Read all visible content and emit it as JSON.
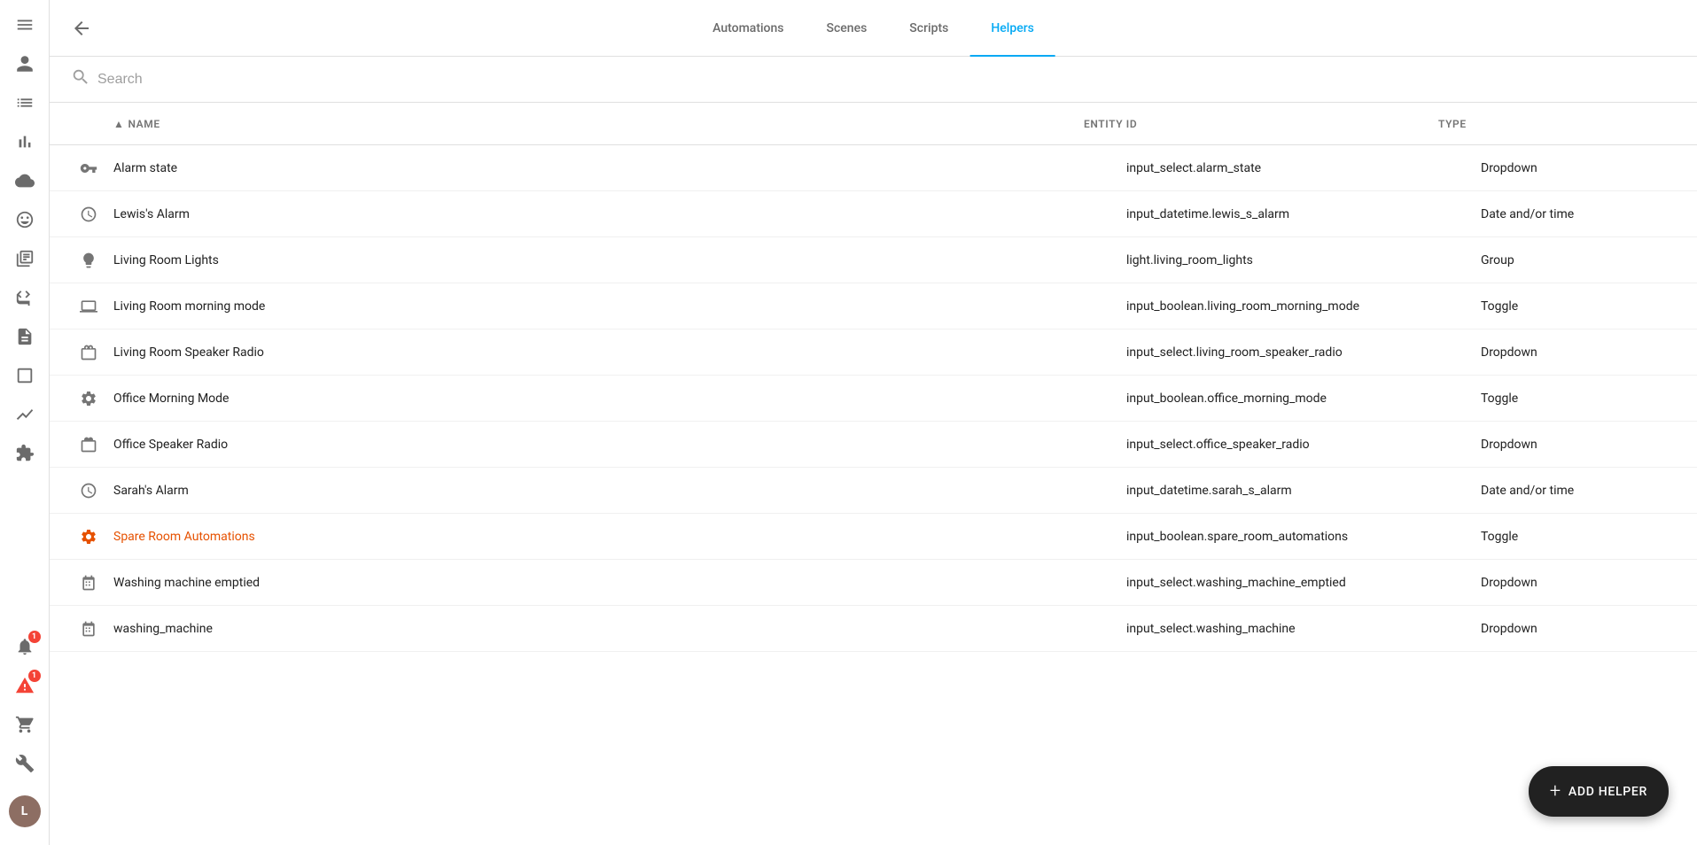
{
  "sidebar": {
    "icons": [
      {
        "name": "menu-icon",
        "symbol": "☰",
        "interactable": true
      },
      {
        "name": "person-icon",
        "symbol": "👤",
        "interactable": true
      },
      {
        "name": "list-icon",
        "symbol": "☰",
        "interactable": true
      },
      {
        "name": "chart-icon",
        "symbol": "📊",
        "interactable": true
      },
      {
        "name": "cloud-icon",
        "symbol": "☁",
        "interactable": true
      },
      {
        "name": "face-icon",
        "symbol": "😊",
        "interactable": true
      },
      {
        "name": "menu2-icon",
        "symbol": "≡",
        "interactable": true
      },
      {
        "name": "radar-icon",
        "symbol": "📡",
        "interactable": true
      },
      {
        "name": "document-icon",
        "symbol": "📋",
        "interactable": true
      },
      {
        "name": "box-icon",
        "symbol": "⬜",
        "interactable": true
      },
      {
        "name": "linechart-icon",
        "symbol": "📈",
        "interactable": true
      },
      {
        "name": "bell-icon",
        "symbol": "🔔",
        "interactable": true,
        "badge": "1"
      },
      {
        "name": "cart-icon",
        "symbol": "🛒",
        "interactable": true
      },
      {
        "name": "wrench-icon",
        "symbol": "🔧",
        "interactable": true
      }
    ],
    "notification_badge": "1"
  },
  "header": {
    "back_label": "←",
    "tabs": [
      {
        "label": "Automations",
        "active": false
      },
      {
        "label": "Scenes",
        "active": false
      },
      {
        "label": "Scripts",
        "active": false
      },
      {
        "label": "Helpers",
        "active": true
      }
    ]
  },
  "search": {
    "placeholder": "Search",
    "value": ""
  },
  "table": {
    "columns": {
      "name": "Name",
      "entity_id": "Entity ID",
      "type": "Type"
    },
    "rows": [
      {
        "icon": "key-icon",
        "icon_symbol": "🔑",
        "name": "Alarm state",
        "highlight": false,
        "entity_id": "input_select.alarm_state",
        "type": "Dropdown"
      },
      {
        "icon": "clock-icon",
        "icon_symbol": "⏰",
        "name": "Lewis's Alarm",
        "highlight": false,
        "entity_id": "input_datetime.lewis_s_alarm",
        "type": "Date and/or time"
      },
      {
        "icon": "bulb-icon",
        "icon_symbol": "💡",
        "name": "Living Room Lights",
        "highlight": false,
        "entity_id": "light.living_room_lights",
        "type": "Group"
      },
      {
        "icon": "laptop-icon",
        "icon_symbol": "💻",
        "name": "Living Room morning mode",
        "highlight": false,
        "entity_id": "input_boolean.living_room_morning_mode",
        "type": "Toggle"
      },
      {
        "icon": "radio-icon",
        "icon_symbol": "📻",
        "name": "Living Room Speaker Radio",
        "highlight": false,
        "entity_id": "input_select.living_room_speaker_radio",
        "type": "Dropdown"
      },
      {
        "icon": "gear-icon",
        "icon_symbol": "⚙",
        "name": "Office Morning Mode",
        "highlight": false,
        "entity_id": "input_boolean.office_morning_mode",
        "type": "Toggle"
      },
      {
        "icon": "radio2-icon",
        "icon_symbol": "📻",
        "name": "Office Speaker Radio",
        "highlight": false,
        "entity_id": "input_select.office_speaker_radio",
        "type": "Dropdown"
      },
      {
        "icon": "clock2-icon",
        "icon_symbol": "⏰",
        "name": "Sarah's Alarm",
        "highlight": false,
        "entity_id": "input_datetime.sarah_s_alarm",
        "type": "Date and/or time"
      },
      {
        "icon": "gear2-icon",
        "icon_symbol": "⚙",
        "name": "Spare Room Automations",
        "highlight": true,
        "entity_id": "input_boolean.spare_room_automations",
        "type": "Toggle"
      },
      {
        "icon": "machine-icon",
        "icon_symbol": "🖨",
        "name": "Washing machine emptied",
        "highlight": false,
        "entity_id": "input_select.washing_machine_emptied",
        "type": "Dropdown"
      },
      {
        "icon": "machine2-icon",
        "icon_symbol": "🖨",
        "name": "washing_machine",
        "highlight": false,
        "entity_id": "input_select.washing_machine",
        "type": "Dropdown"
      }
    ]
  },
  "fab": {
    "label": "ADD HELPER",
    "icon": "+"
  }
}
